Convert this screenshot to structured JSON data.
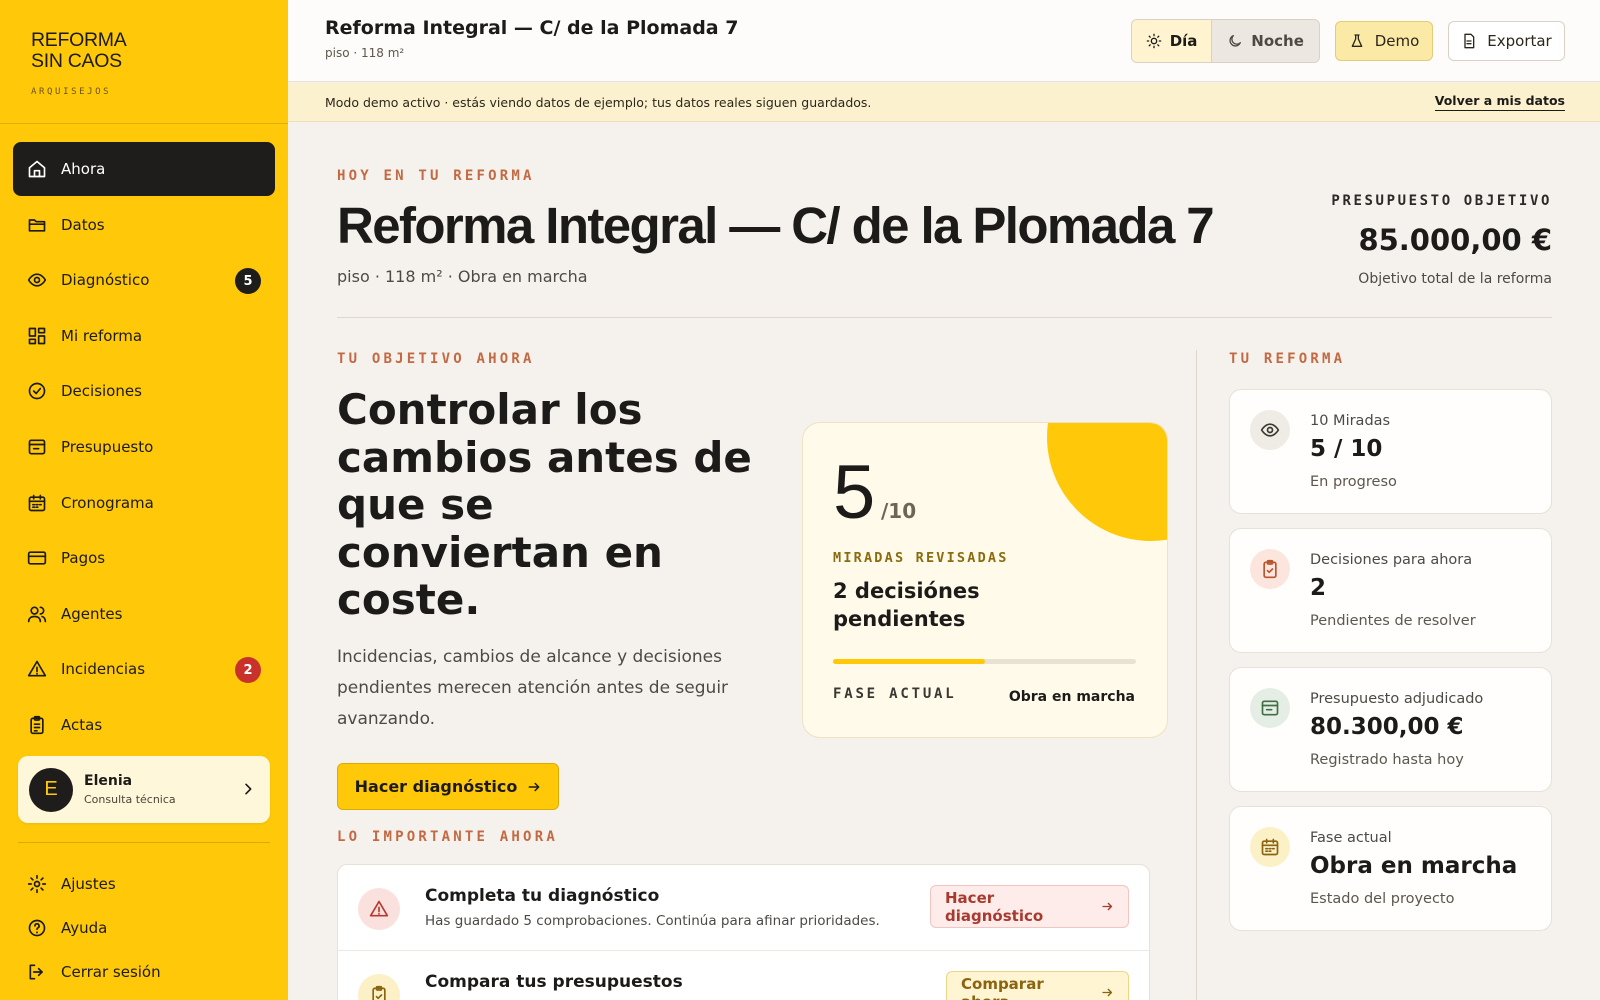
{
  "brand": {
    "line1": "REFORMA",
    "line2": "SIN CAOS",
    "sub": "ARQUISEJOS"
  },
  "nav": {
    "items": [
      {
        "label": "Ahora",
        "icon": "home-icon",
        "active": true
      },
      {
        "label": "Datos",
        "icon": "folder-icon"
      },
      {
        "label": "Diagnóstico",
        "icon": "eye-icon",
        "badge": "5"
      },
      {
        "label": "Mi reforma",
        "icon": "grid-icon"
      },
      {
        "label": "Decisiones",
        "icon": "check-circle-icon"
      },
      {
        "label": "Presupuesto",
        "icon": "wallet-icon"
      },
      {
        "label": "Cronograma",
        "icon": "calendar-icon"
      },
      {
        "label": "Pagos",
        "icon": "credit-card-icon"
      },
      {
        "label": "Agentes",
        "icon": "users-icon"
      },
      {
        "label": "Incidencias",
        "icon": "warning-icon",
        "badge": "2"
      },
      {
        "label": "Actas",
        "icon": "clipboard-icon"
      }
    ]
  },
  "profile": {
    "initial": "E",
    "name": "Elenia",
    "role": "Consulta técnica"
  },
  "footer_nav": [
    {
      "label": "Ajustes",
      "icon": "gear-icon"
    },
    {
      "label": "Ayuda",
      "icon": "help-icon"
    },
    {
      "label": "Cerrar sesión",
      "icon": "logout-icon"
    }
  ],
  "topbar": {
    "title": "Reforma Integral — C/ de la Plomada 7",
    "subtitle": "piso · 118 m²",
    "mode_day": "Día",
    "mode_night": "Noche",
    "demo": "Demo",
    "export": "Exportar"
  },
  "demo_banner": {
    "text": "Modo demo activo · estás viendo datos de ejemplo; tus datos reales siguen guardados.",
    "back": "Volver a mis datos"
  },
  "hero": {
    "eyebrow": "HOY EN TU REFORMA",
    "title": "Reforma Integral — C/ de la Plomada 7",
    "subtitle": "piso · 118 m² · Obra en marcha",
    "budget_label": "PRESUPUESTO OBJETIVO",
    "budget_value": "85.000,00 €",
    "budget_note": "Objetivo total de la reforma"
  },
  "goal": {
    "eyebrow": "TU OBJETIVO AHORA",
    "heading": "Controlar los cambios antes de que se conviertan en coste.",
    "text": "Incidencias, cambios de alcance y decisiones pendientes merecen atención antes de seguir avanzando.",
    "cta": "Hacer diagnóstico"
  },
  "progress": {
    "number": "5",
    "denominator": "/10",
    "label": "MIRADAS REVISADAS",
    "description": "2 decisiónes pendientes",
    "fraction": 0.5,
    "phase_label": "FASE ACTUAL",
    "phase_value": "Obra en marcha"
  },
  "important": {
    "eyebrow": "LO IMPORTANTE AHORA",
    "items": [
      {
        "title": "Completa tu diagnóstico",
        "desc": "Has guardado 5 comprobaciones. Continúa para afinar prioridades.",
        "button": "Hacer diagnóstico",
        "icon": "warning-icon"
      },
      {
        "title": "Compara tus presupuestos",
        "desc": "",
        "button": "Comparar ahora",
        "icon": "clipboard-icon"
      }
    ]
  },
  "reforma": {
    "eyebrow": "TU REFORMA",
    "cards": [
      {
        "label": "10 Miradas",
        "value": "5 / 10",
        "note": "En progreso",
        "icon": "eye-icon"
      },
      {
        "label": "Decisiones para ahora",
        "value": "2",
        "note": "Pendientes de resolver",
        "icon": "clipboard-check-icon"
      },
      {
        "label": "Presupuesto adjudicado",
        "value": "80.300,00 €",
        "note": "Registrado hasta hoy",
        "icon": "wallet-icon"
      },
      {
        "label": "Fase actual",
        "value": "Obra en marcha",
        "note": "Estado del proyecto",
        "icon": "calendar-icon"
      }
    ]
  },
  "colors": {
    "accent": "#ffc90a",
    "dark": "#1f1d1b",
    "eyebrow": "#c26a43",
    "danger": "#c8322a"
  }
}
